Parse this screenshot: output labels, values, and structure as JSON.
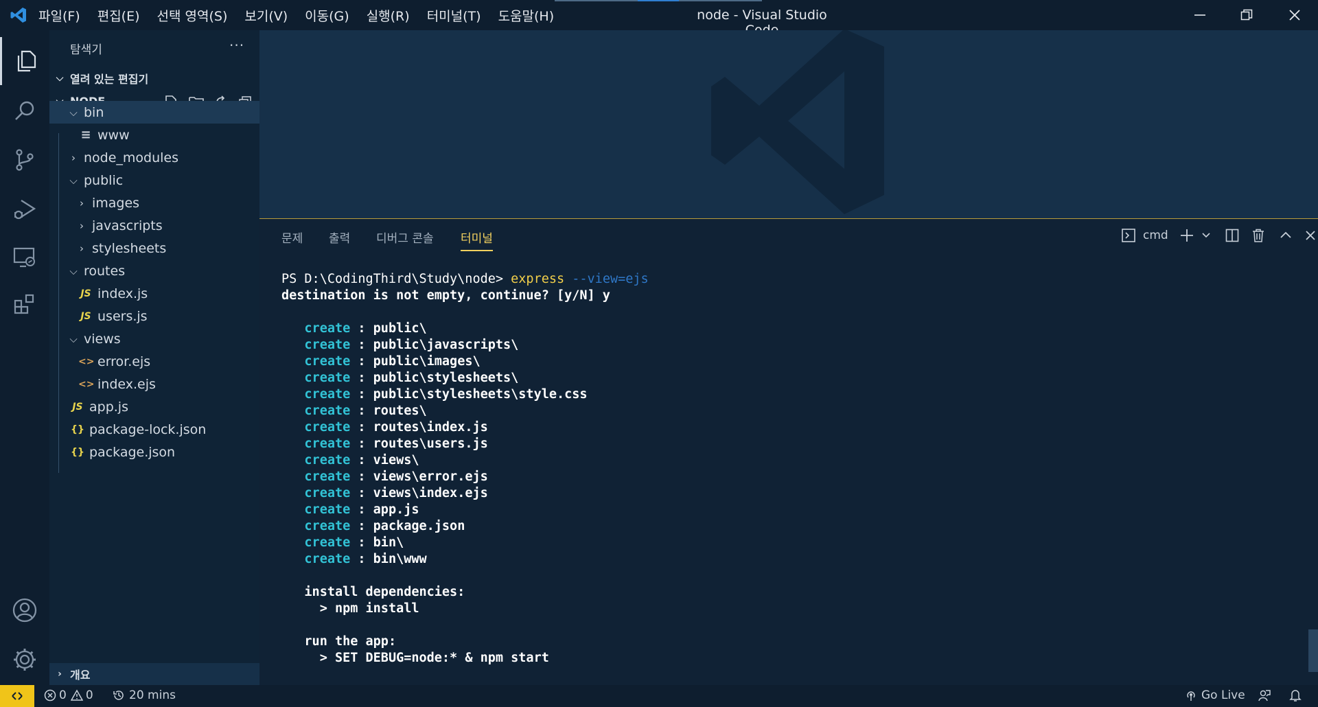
{
  "window": {
    "title": "node - Visual Studio Code",
    "menus": [
      "파일(F)",
      "편집(E)",
      "선택 영역(S)",
      "보기(V)",
      "이동(G)",
      "실행(R)",
      "터미널(T)",
      "도움말(H)"
    ]
  },
  "activity_bar": {
    "items": [
      "explorer-icon",
      "search-icon",
      "source-control-icon",
      "run-debug-icon",
      "remote-explorer-icon",
      "extensions-icon"
    ],
    "bottom": [
      "account-icon",
      "settings-gear-icon"
    ]
  },
  "sidebar": {
    "title": "탐색기",
    "more": "···",
    "open_editors": "열려 있는 편집기",
    "folder": "NODE",
    "tree": [
      {
        "label": "bin",
        "kind": "folder-open"
      },
      {
        "label": "www",
        "kind": "file"
      },
      {
        "label": "node_modules",
        "kind": "folder-closed"
      },
      {
        "label": "public",
        "kind": "folder-open"
      },
      {
        "label": "images",
        "kind": "folder-closed"
      },
      {
        "label": "javascripts",
        "kind": "folder-closed"
      },
      {
        "label": "stylesheets",
        "kind": "folder-closed"
      },
      {
        "label": "routes",
        "kind": "folder-open"
      },
      {
        "label": "index.js",
        "kind": "js"
      },
      {
        "label": "users.js",
        "kind": "js"
      },
      {
        "label": "views",
        "kind": "folder-open"
      },
      {
        "label": "error.ejs",
        "kind": "ejs"
      },
      {
        "label": "index.ejs",
        "kind": "ejs"
      },
      {
        "label": "app.js",
        "kind": "js"
      },
      {
        "label": "package-lock.json",
        "kind": "json"
      },
      {
        "label": "package.json",
        "kind": "json"
      }
    ],
    "icon_badges": {
      "js": "JS",
      "json": "{}",
      "ejs": "<>"
    },
    "outline": "개요"
  },
  "panel": {
    "tabs": [
      "문제",
      "출력",
      "디버그 콘솔",
      "터미널"
    ],
    "active_tab": "터미널",
    "shell": "cmd",
    "terminal": {
      "prompt": "PS D:\\CodingThird\\Study\\node>",
      "command": "express",
      "argument": "--view=ejs",
      "confirm": "destination is not empty, continue? [y/N] y",
      "create_word": "create",
      "created": [
        "public\\",
        "public\\javascripts\\",
        "public\\images\\",
        "public\\stylesheets\\",
        "public\\stylesheets\\style.css",
        "routes\\",
        "routes\\index.js",
        "routes\\users.js",
        "views\\",
        "views\\error.ejs",
        "views\\index.ejs",
        "app.js",
        "package.json",
        "bin\\",
        "bin\\www"
      ],
      "install_heading": "install dependencies:",
      "install_cmd": "> npm install",
      "run_heading": "run the app:",
      "run_cmd": "> SET DEBUG=node:* & npm start"
    }
  },
  "status_bar": {
    "errors": "0",
    "warnings": "0",
    "timer": "20 mins",
    "go_live": "Go Live"
  },
  "colors": {
    "accent_yellow": "#f3d15f",
    "remote_badge": "#f0c419",
    "create_cyan": "#32c3d6"
  }
}
